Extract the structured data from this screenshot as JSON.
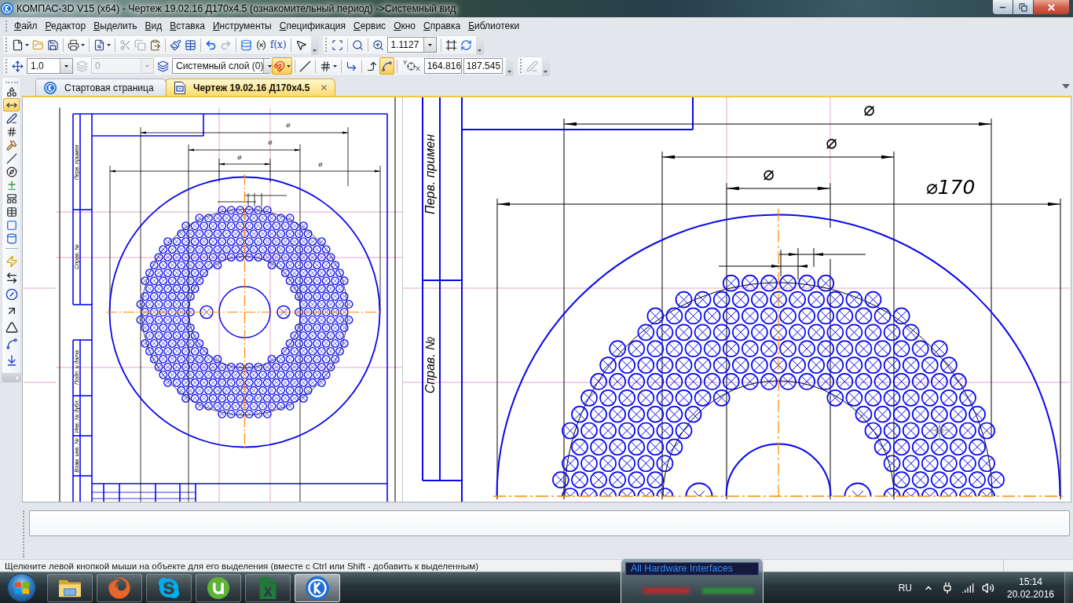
{
  "window": {
    "title": "КОМПАС-3D V15 (x64) - Чертеж 19.02.16 Д170x4.5 (ознакомительный период) ->Системный вид"
  },
  "menu": [
    {
      "label": "Файл"
    },
    {
      "label": "Редактор"
    },
    {
      "label": "Выделить"
    },
    {
      "label": "Вид"
    },
    {
      "label": "Вставка"
    },
    {
      "label": "Инструменты"
    },
    {
      "label": "Спецификация"
    },
    {
      "label": "Сервис"
    },
    {
      "label": "Окно"
    },
    {
      "label": "Справка"
    },
    {
      "label": "Библиотеки"
    }
  ],
  "toolbar_standard": {
    "formula_label": "f(x)",
    "zoom": "1.1127"
  },
  "toolbar_state": {
    "combo_1": "1.0",
    "combo_2": {
      "value": "0",
      "disabled": true
    },
    "layer_combo": "Системный слой (0)",
    "magnet_button": {
      "on": true
    },
    "grid_button": {
      "on": false
    },
    "binding_button": {
      "on": true
    },
    "axis_letters": [
      "Y",
      "X"
    ],
    "coordinate_1": "164.816",
    "coordinate_2": "187.545"
  },
  "tool_palette": [
    {
      "selected": false
    },
    {
      "selected": true
    },
    {
      "selected": false
    },
    {
      "selected": false
    },
    {
      "selected": false
    },
    {
      "selected": false
    },
    {
      "selected": false
    },
    {
      "selected": false
    },
    {
      "selected": false
    },
    {
      "selected": false
    },
    {
      "selected": false
    },
    {
      "selected": false
    }
  ],
  "tabs": [
    {
      "label": "Стартовая страница",
      "selected": false
    },
    {
      "label": "Чертеж 19.02.16 Д170x4.5",
      "selected": true
    }
  ],
  "drawing": {
    "sheet_view": {
      "dimension_labels": [
        "⌀",
        "⌀",
        "⌀",
        "⌀"
      ],
      "stamp_labels": [
        "Перв. примен",
        "Справ. №",
        "Подп. и дата",
        "Инв. № дубл.",
        "Взам. инв. №"
      ]
    },
    "zoomed_view": {
      "dimension_labels": [
        "⌀",
        "⌀",
        "⌀",
        "⌀170"
      ],
      "stamp_labels": [
        "Перв. примен",
        "Справ. №"
      ]
    }
  },
  "status_bar": {
    "hint": "Щелкните левой кнопкой мыши на объекте для его выделения (вместе с Ctrl или Shift - добавить к выделенным)"
  },
  "taskbar": {
    "apps": [
      {
        "selected": false
      },
      {
        "selected": false
      },
      {
        "selected": false
      },
      {
        "selected": false
      },
      {
        "selected": false
      },
      {
        "selected": true
      }
    ],
    "preview": {
      "title": "All Hardware Interfaces"
    },
    "language": "RU",
    "time": "15:14",
    "date": "20.02.2016"
  }
}
